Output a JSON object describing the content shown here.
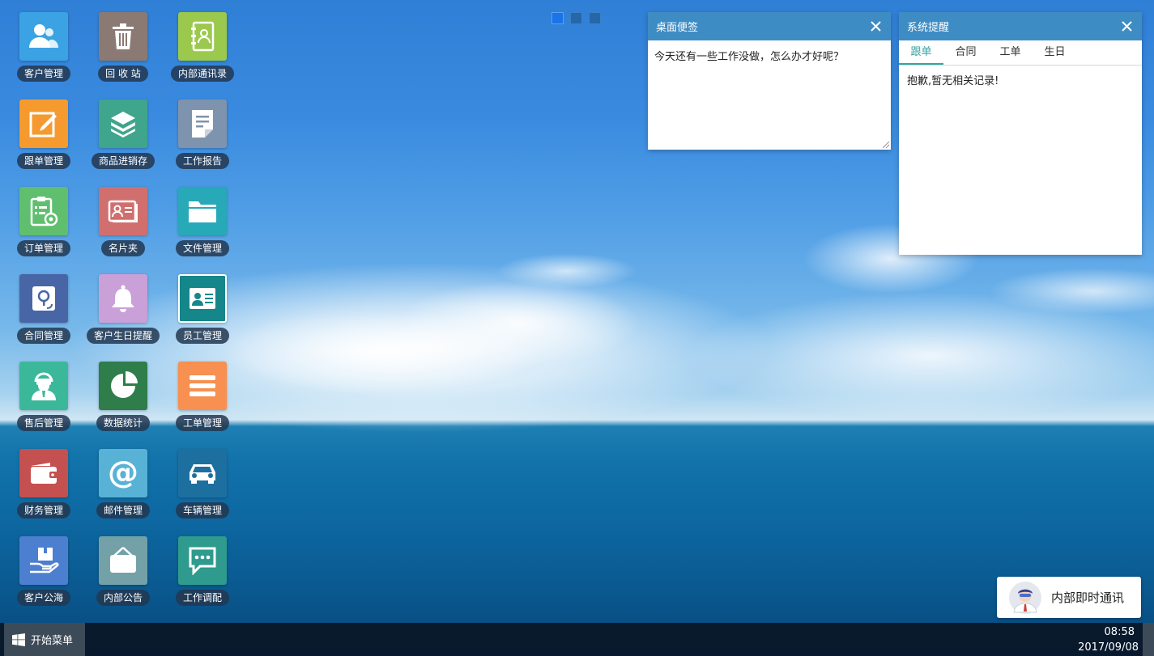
{
  "desktop": {
    "icons": [
      {
        "label": "客户管理",
        "icon": "customers-icon",
        "color": "#3ba3e3"
      },
      {
        "label": "回 收 站",
        "icon": "trash-icon",
        "color": "#8a7a73"
      },
      {
        "label": "内部通讯录",
        "icon": "address-book-icon",
        "color": "#9bc94e"
      },
      {
        "label": "跟单管理",
        "icon": "edit-icon",
        "color": "#f59a2e"
      },
      {
        "label": "商品进销存",
        "icon": "boxes-icon",
        "color": "#3fa58c"
      },
      {
        "label": "工作报告",
        "icon": "report-icon",
        "color": "#7e93ad"
      },
      {
        "label": "订单管理",
        "icon": "clipboard-gear-icon",
        "color": "#5fbf6f"
      },
      {
        "label": "名片夹",
        "icon": "business-card-icon",
        "color": "#d16f6f"
      },
      {
        "label": "文件管理",
        "icon": "folder-icon",
        "color": "#27a9b8"
      },
      {
        "label": "合同管理",
        "icon": "contract-icon",
        "color": "#4866a6"
      },
      {
        "label": "客户生日提醒",
        "icon": "bell-icon",
        "color": "#c9a0d8"
      },
      {
        "label": "员工管理",
        "icon": "employee-card-icon",
        "color": "#15868a"
      },
      {
        "label": "售后管理",
        "icon": "support-agent-icon",
        "color": "#3bb89a"
      },
      {
        "label": "数据统计",
        "icon": "pie-chart-icon",
        "color": "#2e7d4a"
      },
      {
        "label": "工单管理",
        "icon": "list-icon",
        "color": "#f79050"
      },
      {
        "label": "财务管理",
        "icon": "wallet-icon",
        "color": "#c4504f"
      },
      {
        "label": "邮件管理",
        "icon": "at-sign-icon",
        "color": "#58b2d6"
      },
      {
        "label": "车辆管理",
        "icon": "car-icon",
        "color": "#1d6fa0"
      },
      {
        "label": "客户公海",
        "icon": "hand-box-icon",
        "color": "#4d7fd0"
      },
      {
        "label": "内部公告",
        "icon": "notice-board-icon",
        "color": "#74a1a8"
      },
      {
        "label": "工作调配",
        "icon": "chat-bubble-icon",
        "color": "#2f9a8e"
      }
    ]
  },
  "page_dots": {
    "count": 3,
    "active": 0
  },
  "note_widget": {
    "title": "桌面便签",
    "content": "今天还有一些工作没做，怎么办才好呢？"
  },
  "reminder_widget": {
    "title": "系统提醒",
    "tabs": [
      "跟单",
      "合同",
      "工单",
      "生日"
    ],
    "active_tab": "跟单",
    "empty_message": "抱歉,暂无相关记录!"
  },
  "chat": {
    "label": "内部即时通讯"
  },
  "taskbar": {
    "start_label": "开始菜单",
    "time": "08:58",
    "date": "2017/09/08"
  }
}
